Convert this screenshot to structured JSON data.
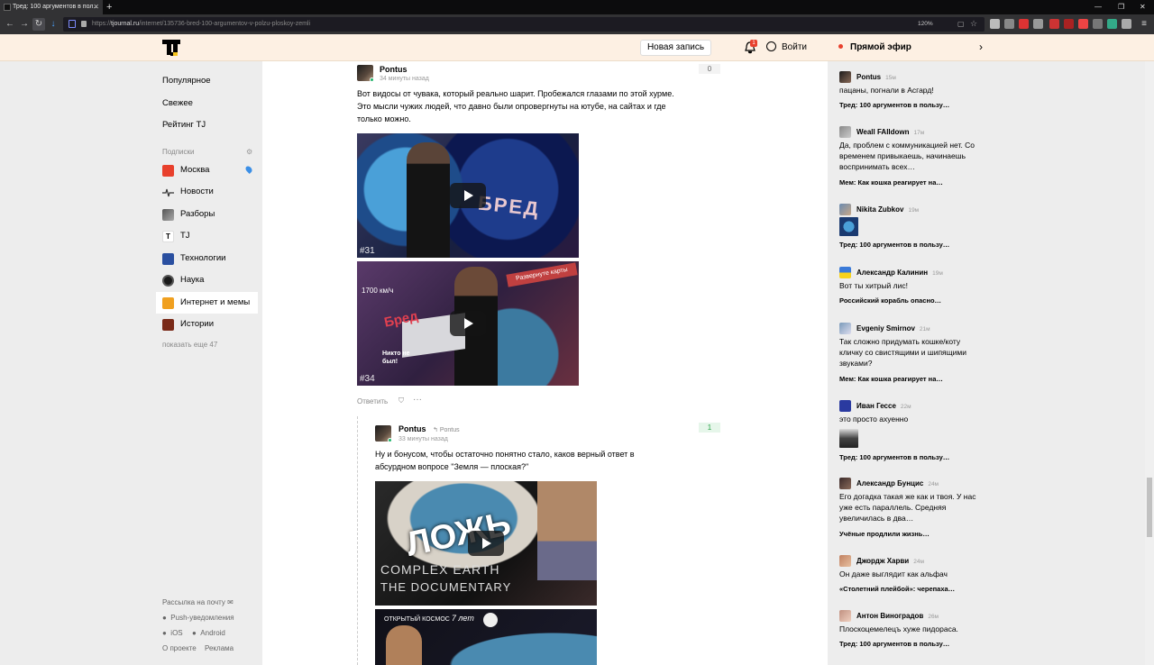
{
  "browser": {
    "tab_title": "Тред: 100 аргументов в пол...",
    "url_prefix": "https://",
    "url_domain": "tjournal.ru",
    "url_path": "/internet/135736-bred-100-argumentov-v-polzu-ploskoy-zemli",
    "zoom": "120%"
  },
  "header": {
    "new_post": "Новая запись",
    "notif_count": "1",
    "login": "Войти",
    "live": "Прямой эфир"
  },
  "nav": {
    "items": [
      "Популярное",
      "Свежее",
      "Рейтинг TJ"
    ],
    "subs_title": "Подписки",
    "subs": [
      "Москва",
      "Новости",
      "Разборы",
      "TJ",
      "Технологии",
      "Наука",
      "Интернет и мемы",
      "Истории"
    ],
    "show_more": "показать еще 47",
    "newsletter": "Рассылка на почту",
    "push": "Push-уведомления",
    "ios": "iOS",
    "android": "Android",
    "about": "О проекте",
    "ads": "Реклама"
  },
  "comments": [
    {
      "author": "Pontus",
      "time": "34 минуты назад",
      "score": "0",
      "text": "Вот видосы от чувака, который реально шарит. Пробежался глазами по этой хурме. Это мысли чужих людей, что давно были опровергнуты на ютубе, на сайтах и где только можно.",
      "video1_word": "БРЕД",
      "video1_tag": "#31",
      "video2_word": "Бред",
      "video2_tag": "#34",
      "video2_speed": "1700 км/ч",
      "video2_banner": "Развернуте карты",
      "video2_note": "Никто не был!",
      "reply": "Ответить"
    },
    {
      "author": "Pontus",
      "reply_to": "Pontus",
      "time": "33 минуты назад",
      "score": "1",
      "text": "Ну и бонусом, чтобы остаточно понятно стало, каков верный ответ в абсурдном вопросе \"Земля — плоская?\"",
      "video1_word": "ЛОЖЬ",
      "video1_sub1": "COMPLEX EARTH",
      "video1_sub2": "THE DOCUMENTARY",
      "video2_title": "ОТКРЫТЫЙ КОСМОС",
      "video2_years": "7 лет"
    }
  ],
  "live_feed": [
    {
      "name": "Pontus",
      "time": "15м",
      "text": "пацаны, погнали в Асгард!",
      "topic": "Тред: 100 аргументов в пользу…"
    },
    {
      "name": "Weall FAlldown",
      "time": "17м",
      "text": "Да, проблем с коммуникацией нет. Со временем привыкаешь, начинаешь воспринимать всех…",
      "topic": "Мем: Как кошка реагирует на…"
    },
    {
      "name": "Nikita Zubkov",
      "time": "19м",
      "text": "",
      "topic": "Тред: 100 аргументов в пользу…"
    },
    {
      "name": "Александр Калинин",
      "time": "19м",
      "text": "Вот ты хитрый лис!",
      "topic": "Российский корабль опасно…"
    },
    {
      "name": "Evgeniy Smirnov",
      "time": "21м",
      "text": "Так сложно придумать кошке/коту кличку со свистящими и шипящими звуками?",
      "topic": "Мем: Как кошка реагирует на…"
    },
    {
      "name": "Иван Гессе",
      "time": "22м",
      "text": "это просто ахуенно",
      "topic": "Тред: 100 аргументов в пользу…"
    },
    {
      "name": "Александр Бунцис",
      "time": "24м",
      "text": "Его догадка такая же как и твоя. У нас уже есть параллель. Средняя увеличилась в два…",
      "topic": "Учёные продлили жизнь…"
    },
    {
      "name": "Джордж Харви",
      "time": "24м",
      "text": "Он даже выглядит как альфач",
      "topic": "«Столетний плейбой»: черепаха…"
    },
    {
      "name": "Антон Виноградов",
      "time": "26м",
      "text": "Плоскоцемелецъ хуже пидораса.",
      "topic": "Тред: 100 аргументов в пользу…"
    }
  ],
  "colors": {
    "header_bg": "#fdf0e3",
    "accent_red": "#e8402c",
    "score_positive": "#27a347"
  }
}
